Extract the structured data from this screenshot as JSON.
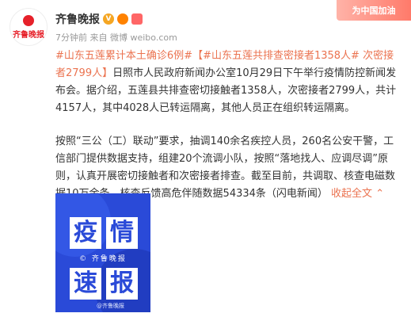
{
  "author": {
    "avatar_text": "齐鲁晚报",
    "name": "齐鲁晚报",
    "meta": "7分钟前 来自 微博 weibo.com"
  },
  "corner_banner": "为中国加油",
  "post": {
    "tag1": "#山东五莲累计本土确诊6例#",
    "tag2": "【#山东五莲共排查密接者1358人# 次密接者2799人】",
    "text1": "日照市人民政府新闻办公室10月29日下午举行疫情防控新闻发布会。据介绍，五莲县共排查密切接触者1358人，次密接者2799人，共计4157人，其中4028人已转运隔离，其他人员正在组织转运隔离。",
    "text2": "按照“三公（工）联动”要求，抽调140余名疾控人员，260名公安干警，工信部门提供数据支持，组建20个流调小队，按照“落地找人、应调尽调”原则，认真开展密切接触者和次密接者排查。截至目前，共调取、核查电磁数据10万余条，核查反馈高危伴随数据54334条（闪电新闻）",
    "expand_label": "收起全文",
    "expand_arrow": "⌃"
  },
  "image": {
    "title_chars": [
      "疫",
      "情",
      "速",
      "报"
    ],
    "middle_text": "© 齐鲁晚报",
    "watermark": "@齐鲁晚报"
  }
}
